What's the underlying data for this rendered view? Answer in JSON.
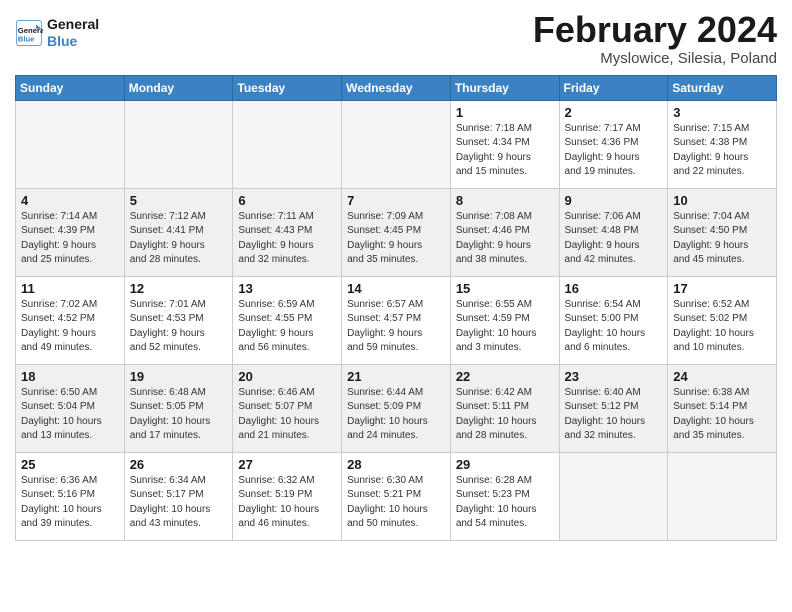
{
  "header": {
    "logo_line1": "General",
    "logo_line2": "Blue",
    "month": "February 2024",
    "location": "Myslowice, Silesia, Poland"
  },
  "weekdays": [
    "Sunday",
    "Monday",
    "Tuesday",
    "Wednesday",
    "Thursday",
    "Friday",
    "Saturday"
  ],
  "weeks": [
    [
      {
        "day": "",
        "info": "",
        "empty": true
      },
      {
        "day": "",
        "info": "",
        "empty": true
      },
      {
        "day": "",
        "info": "",
        "empty": true
      },
      {
        "day": "",
        "info": "",
        "empty": true
      },
      {
        "day": "1",
        "info": "Sunrise: 7:18 AM\nSunset: 4:34 PM\nDaylight: 9 hours\nand 15 minutes."
      },
      {
        "day": "2",
        "info": "Sunrise: 7:17 AM\nSunset: 4:36 PM\nDaylight: 9 hours\nand 19 minutes."
      },
      {
        "day": "3",
        "info": "Sunrise: 7:15 AM\nSunset: 4:38 PM\nDaylight: 9 hours\nand 22 minutes."
      }
    ],
    [
      {
        "day": "4",
        "info": "Sunrise: 7:14 AM\nSunset: 4:39 PM\nDaylight: 9 hours\nand 25 minutes."
      },
      {
        "day": "5",
        "info": "Sunrise: 7:12 AM\nSunset: 4:41 PM\nDaylight: 9 hours\nand 28 minutes."
      },
      {
        "day": "6",
        "info": "Sunrise: 7:11 AM\nSunset: 4:43 PM\nDaylight: 9 hours\nand 32 minutes."
      },
      {
        "day": "7",
        "info": "Sunrise: 7:09 AM\nSunset: 4:45 PM\nDaylight: 9 hours\nand 35 minutes."
      },
      {
        "day": "8",
        "info": "Sunrise: 7:08 AM\nSunset: 4:46 PM\nDaylight: 9 hours\nand 38 minutes."
      },
      {
        "day": "9",
        "info": "Sunrise: 7:06 AM\nSunset: 4:48 PM\nDaylight: 9 hours\nand 42 minutes."
      },
      {
        "day": "10",
        "info": "Sunrise: 7:04 AM\nSunset: 4:50 PM\nDaylight: 9 hours\nand 45 minutes."
      }
    ],
    [
      {
        "day": "11",
        "info": "Sunrise: 7:02 AM\nSunset: 4:52 PM\nDaylight: 9 hours\nand 49 minutes."
      },
      {
        "day": "12",
        "info": "Sunrise: 7:01 AM\nSunset: 4:53 PM\nDaylight: 9 hours\nand 52 minutes."
      },
      {
        "day": "13",
        "info": "Sunrise: 6:59 AM\nSunset: 4:55 PM\nDaylight: 9 hours\nand 56 minutes."
      },
      {
        "day": "14",
        "info": "Sunrise: 6:57 AM\nSunset: 4:57 PM\nDaylight: 9 hours\nand 59 minutes."
      },
      {
        "day": "15",
        "info": "Sunrise: 6:55 AM\nSunset: 4:59 PM\nDaylight: 10 hours\nand 3 minutes."
      },
      {
        "day": "16",
        "info": "Sunrise: 6:54 AM\nSunset: 5:00 PM\nDaylight: 10 hours\nand 6 minutes."
      },
      {
        "day": "17",
        "info": "Sunrise: 6:52 AM\nSunset: 5:02 PM\nDaylight: 10 hours\nand 10 minutes."
      }
    ],
    [
      {
        "day": "18",
        "info": "Sunrise: 6:50 AM\nSunset: 5:04 PM\nDaylight: 10 hours\nand 13 minutes."
      },
      {
        "day": "19",
        "info": "Sunrise: 6:48 AM\nSunset: 5:05 PM\nDaylight: 10 hours\nand 17 minutes."
      },
      {
        "day": "20",
        "info": "Sunrise: 6:46 AM\nSunset: 5:07 PM\nDaylight: 10 hours\nand 21 minutes."
      },
      {
        "day": "21",
        "info": "Sunrise: 6:44 AM\nSunset: 5:09 PM\nDaylight: 10 hours\nand 24 minutes."
      },
      {
        "day": "22",
        "info": "Sunrise: 6:42 AM\nSunset: 5:11 PM\nDaylight: 10 hours\nand 28 minutes."
      },
      {
        "day": "23",
        "info": "Sunrise: 6:40 AM\nSunset: 5:12 PM\nDaylight: 10 hours\nand 32 minutes."
      },
      {
        "day": "24",
        "info": "Sunrise: 6:38 AM\nSunset: 5:14 PM\nDaylight: 10 hours\nand 35 minutes."
      }
    ],
    [
      {
        "day": "25",
        "info": "Sunrise: 6:36 AM\nSunset: 5:16 PM\nDaylight: 10 hours\nand 39 minutes."
      },
      {
        "day": "26",
        "info": "Sunrise: 6:34 AM\nSunset: 5:17 PM\nDaylight: 10 hours\nand 43 minutes."
      },
      {
        "day": "27",
        "info": "Sunrise: 6:32 AM\nSunset: 5:19 PM\nDaylight: 10 hours\nand 46 minutes."
      },
      {
        "day": "28",
        "info": "Sunrise: 6:30 AM\nSunset: 5:21 PM\nDaylight: 10 hours\nand 50 minutes."
      },
      {
        "day": "29",
        "info": "Sunrise: 6:28 AM\nSunset: 5:23 PM\nDaylight: 10 hours\nand 54 minutes."
      },
      {
        "day": "",
        "info": "",
        "empty": true
      },
      {
        "day": "",
        "info": "",
        "empty": true
      }
    ]
  ]
}
